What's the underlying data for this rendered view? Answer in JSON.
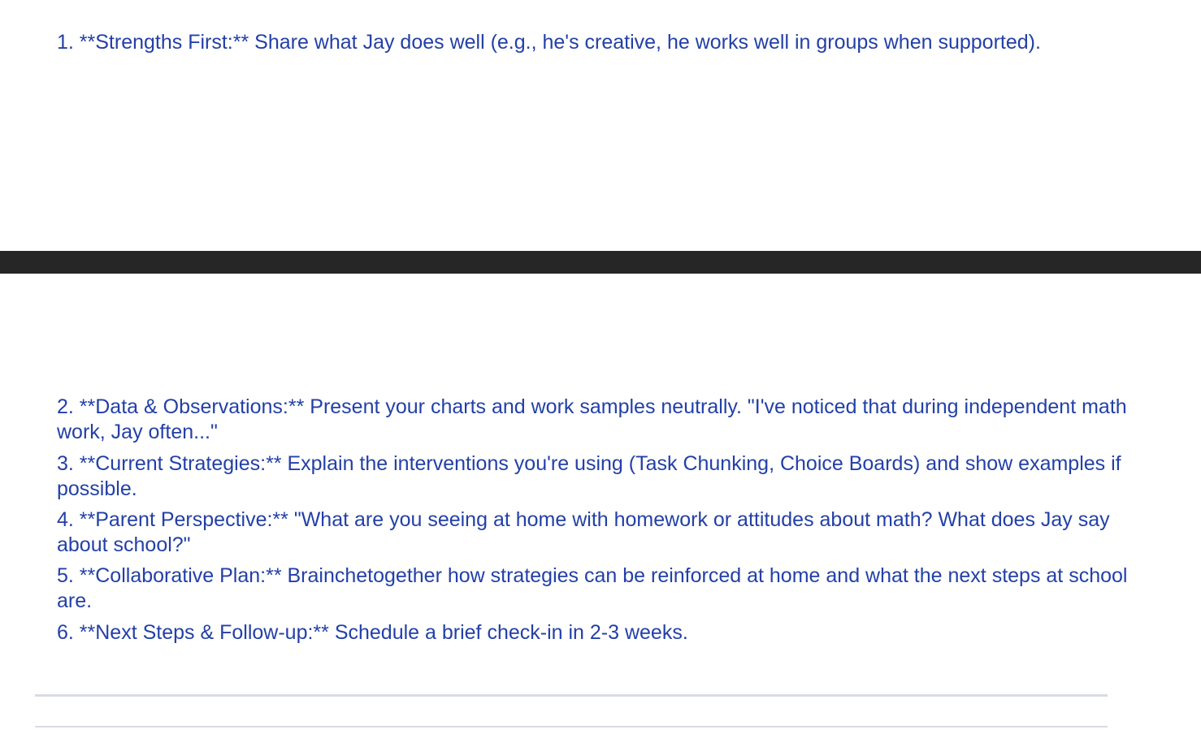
{
  "items": [
    "1. **Strengths First:** Share what Jay does well (e.g., he's creative, he works well in groups when supported).",
    "2. **Data & Observations:** Present your charts and work samples neutrally. \"I've noticed that during independent math work, Jay often...\"",
    "3. **Current Strategies:** Explain the interventions you're using (Task Chunking, Choice Boards) and show examples if possible.",
    "4. **Parent Perspective:** \"What are you seeing at home with homework or attitudes about math? What does Jay say about school?\"",
    "5. **Collaborative Plan:** Brainchetogether how strategies can be reinforced at home and what the next steps at school are.",
    "6. **Next Steps & Follow-up:** Schedule a brief check-in in 2-3 weeks."
  ],
  "colors": {
    "text": "#2340a8",
    "divider_bar": "#262626",
    "rule": "#d9dbe6",
    "background": "#ffffff"
  }
}
